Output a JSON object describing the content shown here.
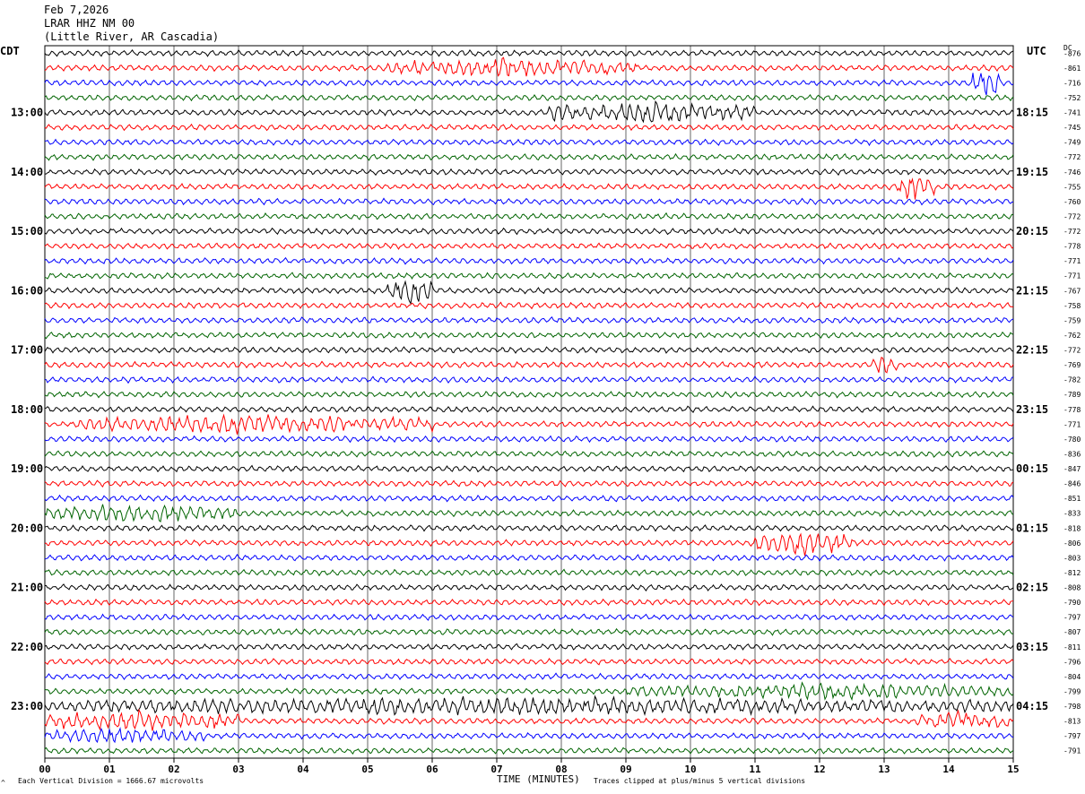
{
  "header": {
    "date": "Feb 7,2026",
    "station": "LRAR HHZ NM 00",
    "location": "(Little River, AR Cascadia)"
  },
  "footer": {
    "scale_note": "Each Vertical Division = 1666.67 microvolts",
    "clip_note": "Traces clipped at plus/minus 5 vertical divisions",
    "corner_mark": "^"
  },
  "chart_data": {
    "type": "helicorder",
    "xlabel": "TIME (MINUTES)",
    "x_ticks": [
      "00",
      "01",
      "02",
      "03",
      "04",
      "05",
      "06",
      "07",
      "08",
      "09",
      "10",
      "11",
      "12",
      "13",
      "14",
      "15"
    ],
    "xlim": [
      0,
      15
    ],
    "left_zone_label": "CDT",
    "right_zone_label": "UTC",
    "dc_label": "DC",
    "grid": true,
    "trace_colors": [
      "#000000",
      "#ff0000",
      "#0000ff",
      "#006400"
    ],
    "lines": [
      {
        "dc": "-876",
        "left": "",
        "right": ""
      },
      {
        "dc": "-861",
        "left": "",
        "right": ""
      },
      {
        "dc": "-716",
        "left": "",
        "right": ""
      },
      {
        "dc": "-752",
        "left": "",
        "right": ""
      },
      {
        "dc": "-741",
        "left": "13:00",
        "right": "18:15"
      },
      {
        "dc": "-745",
        "left": "",
        "right": ""
      },
      {
        "dc": "-749",
        "left": "",
        "right": ""
      },
      {
        "dc": "-772",
        "left": "",
        "right": ""
      },
      {
        "dc": "-746",
        "left": "14:00",
        "right": "19:15"
      },
      {
        "dc": "-755",
        "left": "",
        "right": ""
      },
      {
        "dc": "-760",
        "left": "",
        "right": ""
      },
      {
        "dc": "-772",
        "left": "",
        "right": ""
      },
      {
        "dc": "-772",
        "left": "15:00",
        "right": "20:15"
      },
      {
        "dc": "-778",
        "left": "",
        "right": ""
      },
      {
        "dc": "-771",
        "left": "",
        "right": ""
      },
      {
        "dc": "-771",
        "left": "",
        "right": ""
      },
      {
        "dc": "-767",
        "left": "16:00",
        "right": "21:15"
      },
      {
        "dc": "-758",
        "left": "",
        "right": ""
      },
      {
        "dc": "-759",
        "left": "",
        "right": ""
      },
      {
        "dc": "-762",
        "left": "",
        "right": ""
      },
      {
        "dc": "-772",
        "left": "17:00",
        "right": "22:15"
      },
      {
        "dc": "-769",
        "left": "",
        "right": ""
      },
      {
        "dc": "-782",
        "left": "",
        "right": ""
      },
      {
        "dc": "-789",
        "left": "",
        "right": ""
      },
      {
        "dc": "-778",
        "left": "18:00",
        "right": "23:15"
      },
      {
        "dc": "-771",
        "left": "",
        "right": ""
      },
      {
        "dc": "-780",
        "left": "",
        "right": ""
      },
      {
        "dc": "-836",
        "left": "",
        "right": ""
      },
      {
        "dc": "-847",
        "left": "19:00",
        "right": "00:15"
      },
      {
        "dc": "-846",
        "left": "",
        "right": ""
      },
      {
        "dc": "-851",
        "left": "",
        "right": ""
      },
      {
        "dc": "-833",
        "left": "",
        "right": ""
      },
      {
        "dc": "-818",
        "left": "20:00",
        "right": "01:15"
      },
      {
        "dc": "-806",
        "left": "",
        "right": ""
      },
      {
        "dc": "-803",
        "left": "",
        "right": ""
      },
      {
        "dc": "-812",
        "left": "",
        "right": ""
      },
      {
        "dc": "-808",
        "left": "21:00",
        "right": "02:15"
      },
      {
        "dc": "-790",
        "left": "",
        "right": ""
      },
      {
        "dc": "-797",
        "left": "",
        "right": ""
      },
      {
        "dc": "-807",
        "left": "",
        "right": ""
      },
      {
        "dc": "-811",
        "left": "22:00",
        "right": "03:15"
      },
      {
        "dc": "-796",
        "left": "",
        "right": ""
      },
      {
        "dc": "-804",
        "left": "",
        "right": ""
      },
      {
        "dc": "-799",
        "left": "",
        "right": ""
      },
      {
        "dc": "-798",
        "left": "23:00",
        "right": "04:15"
      },
      {
        "dc": "-813",
        "left": "",
        "right": ""
      },
      {
        "dc": "-797",
        "left": "",
        "right": ""
      },
      {
        "dc": "-791",
        "left": "",
        "right": ""
      }
    ],
    "events": [
      {
        "line": 1,
        "start": 5.2,
        "end": 9.2,
        "amp": 2.0
      },
      {
        "line": 2,
        "start": 14.3,
        "end": 14.8,
        "amp": 4.0
      },
      {
        "line": 4,
        "start": 7.8,
        "end": 11.0,
        "amp": 2.5
      },
      {
        "line": 9,
        "start": 13.2,
        "end": 13.8,
        "amp": 3.5
      },
      {
        "line": 16,
        "start": 5.3,
        "end": 6.0,
        "amp": 3.0
      },
      {
        "line": 21,
        "start": 12.8,
        "end": 13.2,
        "amp": 2.0
      },
      {
        "line": 25,
        "start": 0.5,
        "end": 6.0,
        "amp": 2.0
      },
      {
        "line": 31,
        "start": 0.0,
        "end": 3.0,
        "amp": 2.0
      },
      {
        "line": 33,
        "start": 11.0,
        "end": 12.5,
        "amp": 3.0
      },
      {
        "line": 43,
        "start": 9.0,
        "end": 15.0,
        "amp": 1.6
      },
      {
        "line": 44,
        "start": 0.0,
        "end": 15.0,
        "amp": 1.8
      },
      {
        "line": 45,
        "start": 0.0,
        "end": 3.0,
        "amp": 2.2
      },
      {
        "line": 45,
        "start": 13.5,
        "end": 15.0,
        "amp": 2.0
      },
      {
        "line": 46,
        "start": 0.0,
        "end": 2.5,
        "amp": 1.6
      }
    ]
  }
}
